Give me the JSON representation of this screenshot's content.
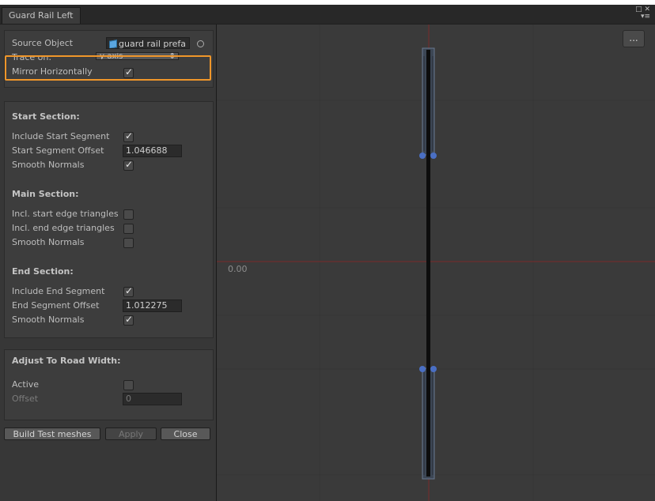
{
  "window": {
    "tab_title": "Guard Rail Left",
    "icons": [
      "maximize-icon",
      "close-icon",
      "menu-icon"
    ]
  },
  "source": {
    "source_object_label": "Source Object",
    "source_object_value": "guard rail prefa",
    "trace_on_label": "Trace on:",
    "trace_on_value": "y-axis",
    "mirror_label": "Mirror Horizontally",
    "mirror_checked": true
  },
  "start_section": {
    "title": "Start Section:",
    "include_label": "Include Start Segment",
    "include_checked": true,
    "offset_label": "Start Segment Offset",
    "offset_value": "1.046688",
    "smooth_label": "Smooth Normals",
    "smooth_checked": true
  },
  "main_section": {
    "title": "Main Section:",
    "start_edge_label": "Incl. start edge triangles",
    "start_edge_checked": false,
    "end_edge_label": "Incl. end edge triangles",
    "end_edge_checked": false,
    "smooth_label": "Smooth Normals",
    "smooth_checked": false
  },
  "end_section": {
    "title": "End Section:",
    "include_label": "Include End Segment",
    "include_checked": true,
    "offset_label": "End Segment Offset",
    "offset_value": "1.012275",
    "smooth_label": "Smooth Normals",
    "smooth_checked": true
  },
  "road_width": {
    "title": "Adjust To Road Width:",
    "active_label": "Active",
    "active_checked": false,
    "offset_label": "Offset",
    "offset_value": "0"
  },
  "buttons": {
    "build": "Build Test meshes",
    "apply": "Apply",
    "close": "Close"
  },
  "viewport": {
    "more_label": "...",
    "axis_label": "0.00"
  },
  "colors": {
    "highlight": "#f0962a",
    "handle": "#4a6fc4",
    "axis": "#8a3030"
  }
}
